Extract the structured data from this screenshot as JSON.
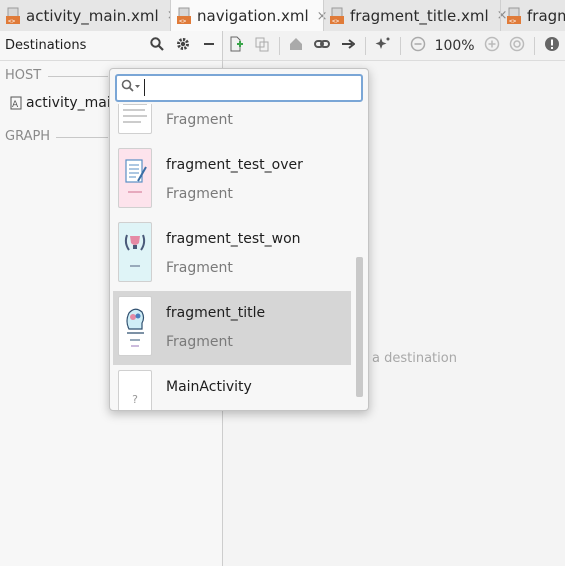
{
  "tabs": [
    {
      "label": "activity_main.xml",
      "active": false
    },
    {
      "label": "navigation.xml",
      "active": true
    },
    {
      "label": "fragment_title.xml",
      "active": false
    },
    {
      "label": "fragm",
      "active": false
    }
  ],
  "tab_close_glyph": "×",
  "left_panel": {
    "title": "Destinations",
    "icons": [
      "search-icon",
      "gear-icon",
      "minimize-icon"
    ],
    "host_section": "HOST",
    "host_item": "activity_main",
    "graph_section": "GRAPH"
  },
  "toolbar": {
    "zoom_level": "100%",
    "icons": [
      "new-destination-icon",
      "nest-graph-icon",
      "home-icon",
      "link-icon",
      "arrow-icon",
      "auto-arrange-icon",
      "zoom-out-icon",
      "zoom-in-icon",
      "zoom-fit-icon",
      "warning-icon"
    ]
  },
  "canvas": {
    "hint_text": "a destination"
  },
  "popup": {
    "search_value": "",
    "items": [
      {
        "name": "",
        "type": "Fragment",
        "selected": false,
        "thumb": "doc"
      },
      {
        "name": "fragment_test_over",
        "type": "Fragment",
        "selected": false,
        "thumb": "checklist"
      },
      {
        "name": "fragment_test_won",
        "type": "Fragment",
        "selected": false,
        "thumb": "trophy"
      },
      {
        "name": "fragment_title",
        "type": "Fragment",
        "selected": true,
        "thumb": "brain"
      },
      {
        "name": "MainActivity",
        "type": "",
        "selected": false,
        "thumb": "unknown"
      }
    ],
    "unknown_thumb_glyph": "?"
  },
  "colors": {
    "accent": "#7aa6d6",
    "selected_row": "#d6d6d6",
    "add_icon_green": "#3aa54a",
    "xml_icon_orange": "#e07b39"
  }
}
